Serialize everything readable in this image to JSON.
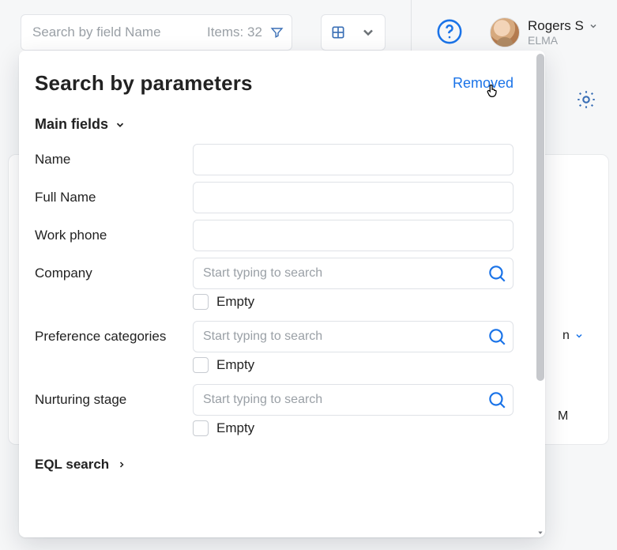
{
  "topbar": {
    "search_placeholder": "Search by field Name",
    "items_label": "Items: 32"
  },
  "user": {
    "name": "Rogers S",
    "org": "ELMA"
  },
  "panel": {
    "title": "Search by parameters",
    "removed": "Removed",
    "section_main": "Main fields",
    "eql": "EQL search",
    "search_placeholder": "Start typing to search",
    "empty_label": "Empty",
    "fields": {
      "name": "Name",
      "fullname": "Full Name",
      "workphone": "Work phone",
      "company": "Company",
      "prefcat": "Preference categories",
      "nurturing": "Nurturing stage"
    }
  },
  "background": {
    "right_n": "n",
    "right_m": "M"
  }
}
